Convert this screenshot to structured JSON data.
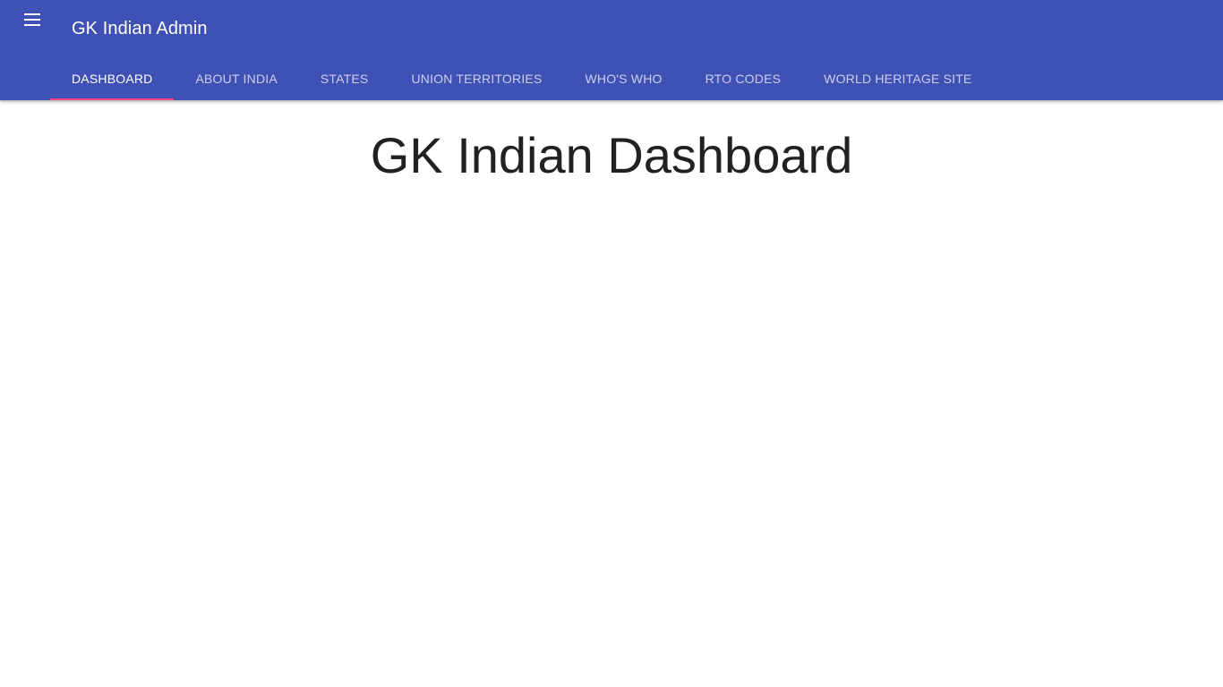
{
  "appbar": {
    "title": "GK Indian Admin",
    "color": "#3f51b5",
    "menu_icon": "hamburger-menu-icon"
  },
  "tabs": [
    {
      "label": "DASHBOARD",
      "active": true
    },
    {
      "label": "ABOUT INDIA",
      "active": false
    },
    {
      "label": "STATES",
      "active": false
    },
    {
      "label": "UNION TERRITORIES",
      "active": false
    },
    {
      "label": "WHO'S WHO",
      "active": false
    },
    {
      "label": "RTO CODES",
      "active": false
    },
    {
      "label": "WORLD HERITAGE SITE",
      "active": false
    }
  ],
  "tab_indicator_color": "#ff4081",
  "main": {
    "heading": "GK Indian Dashboard"
  }
}
